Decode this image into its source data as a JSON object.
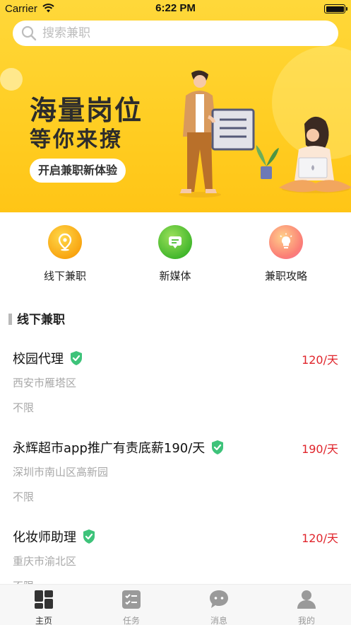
{
  "status_bar": {
    "carrier": "Carrier",
    "time": "6:22 PM"
  },
  "search": {
    "placeholder": "搜索兼职"
  },
  "banner": {
    "headline": "海量岗位",
    "subheadline": "等你来撩",
    "button_label": "开启兼职新体验"
  },
  "categories": [
    {
      "label": "线下兼职",
      "icon": "location-pin-icon"
    },
    {
      "label": "新媒体",
      "icon": "message-doc-icon"
    },
    {
      "label": "兼职攻略",
      "icon": "lightbulb-icon"
    }
  ],
  "section": {
    "title": "线下兼职"
  },
  "jobs": [
    {
      "title": "校园代理",
      "salary": "120/天",
      "location": "西安市雁塔区",
      "requirement": "不限"
    },
    {
      "title": "永辉超市app推广有责底薪190/天",
      "salary": "190/天",
      "location": "深圳市南山区高新园",
      "requirement": "不限"
    },
    {
      "title": "化妆师助理",
      "salary": "120/天",
      "location": "重庆市渝北区",
      "requirement": "不限"
    }
  ],
  "tabs": [
    {
      "label": "主页",
      "icon": "home-grid-icon",
      "active": true
    },
    {
      "label": "任务",
      "icon": "checklist-icon",
      "active": false
    },
    {
      "label": "消息",
      "icon": "chat-bubble-icon",
      "active": false
    },
    {
      "label": "我的",
      "icon": "user-icon",
      "active": false
    }
  ],
  "colors": {
    "banner_yellow": "#ffcd22",
    "salary_red": "#e0242b",
    "verified_green": "#3ec37a"
  }
}
